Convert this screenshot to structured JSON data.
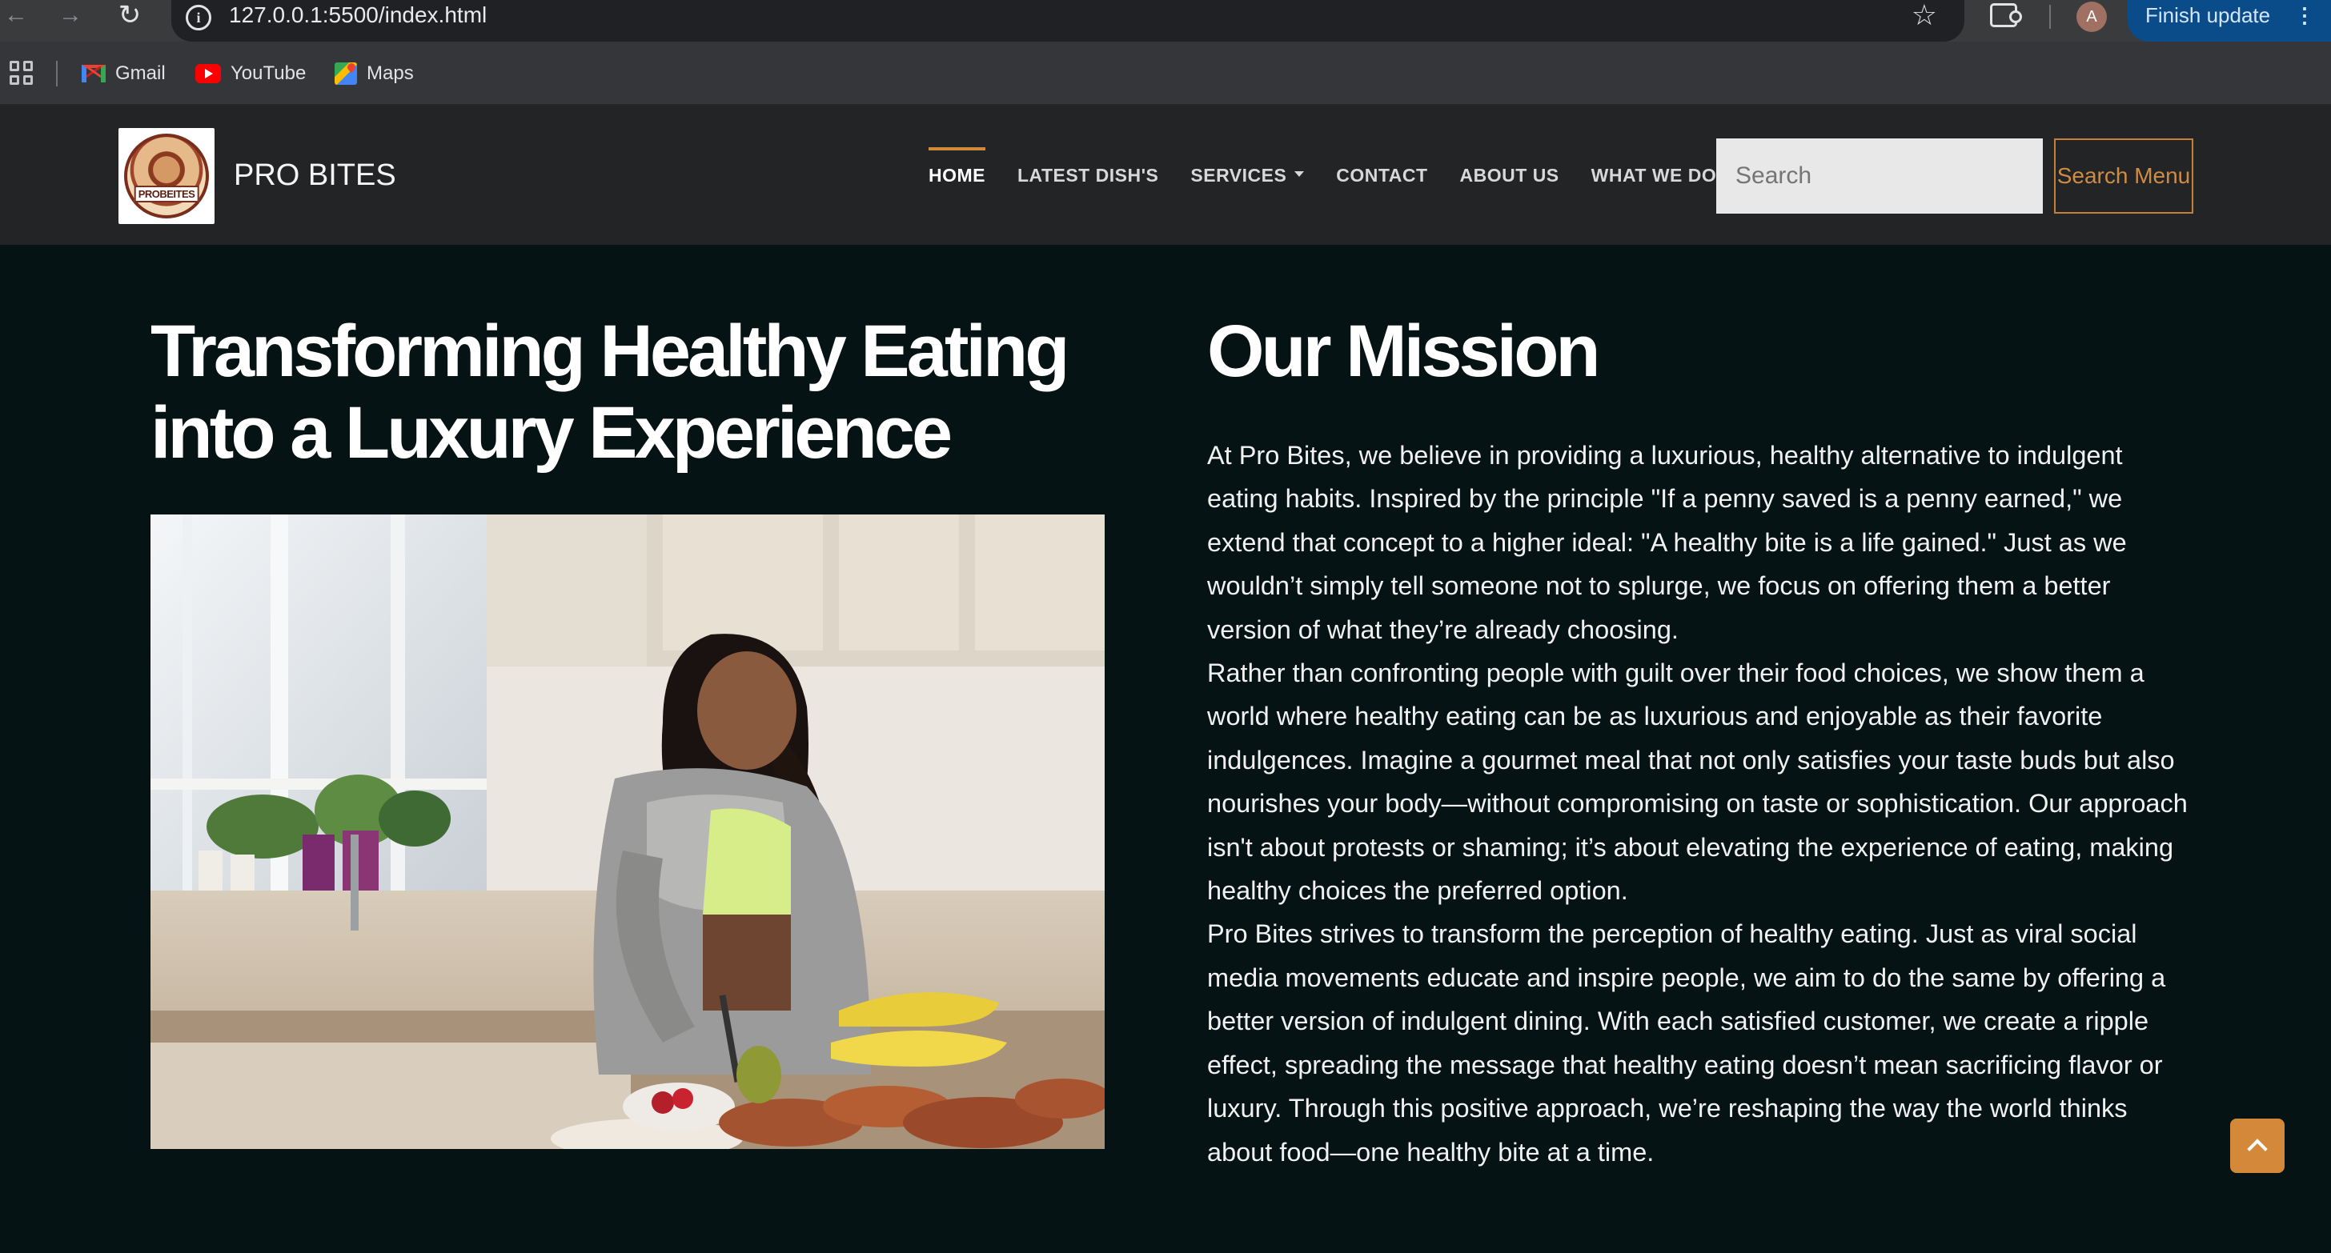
{
  "browser": {
    "url": "127.0.0.1:5500/index.html",
    "profile_initial": "A",
    "update_label": "Finish update",
    "bookmarks": [
      {
        "label": "Gmail",
        "icon": "gmail-icon"
      },
      {
        "label": "YouTube",
        "icon": "youtube-icon"
      },
      {
        "label": "Maps",
        "icon": "maps-icon"
      }
    ]
  },
  "site": {
    "brand": "PRO BITES",
    "logo_text": "PROBEITES",
    "nav": [
      {
        "label": "HOME",
        "active": true
      },
      {
        "label": "LATEST DISH'S",
        "active": false
      },
      {
        "label": "SERVICES",
        "active": false,
        "dropdown": true
      },
      {
        "label": "CONTACT",
        "active": false
      },
      {
        "label": "ABOUT US",
        "active": false
      },
      {
        "label": "WHAT WE DO",
        "active": false
      }
    ],
    "search_placeholder": "Search",
    "search_button": "Search Menu",
    "accent_color": "#d4893a"
  },
  "hero": {
    "headline": "Transforming Healthy Eating into a Luxury Experience",
    "photo_alt": "Woman chopping fruit in a kitchen"
  },
  "mission": {
    "title": "Our Mission",
    "paragraphs": [
      "At Pro Bites, we believe in providing a luxurious, healthy alternative to indulgent eating habits. Inspired by the principle \"If a penny saved is a penny earned,\" we extend that concept to a higher ideal: \"A healthy bite is a life gained.\" Just as we wouldn’t simply tell someone not to splurge, we focus on offering them a better version of what they’re already choosing.",
      "Rather than confronting people with guilt over their food choices, we show them a world where healthy eating can be as luxurious and enjoyable as their favorite indulgences. Imagine a gourmet meal that not only satisfies your taste buds but also nourishes your body—without compromising on taste or sophistication. Our approach isn't about protests or shaming; it’s about elevating the experience of eating, making healthy choices the preferred option.",
      "Pro Bites strives to transform the perception of healthy eating. Just as viral social media movements educate and inspire people, we aim to do the same by offering a better version of indulgent dining. With each satisfied customer, we create a ripple effect, spreading the message that healthy eating doesn’t mean sacrificing flavor or luxury. Through this positive approach, we’re reshaping the way the world thinks about food—one healthy bite at a time."
    ]
  }
}
